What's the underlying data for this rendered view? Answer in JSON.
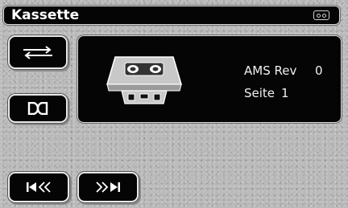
{
  "title_bar": {
    "title": "Kassette",
    "icon": "cassette-icon"
  },
  "buttons": {
    "repeat": {
      "icon": "repeat-arrows-icon"
    },
    "dolby": {
      "icon": "dolby-icon"
    },
    "rewind": {
      "icon": "skip-back-icon"
    },
    "forward": {
      "icon": "skip-forward-icon"
    }
  },
  "display": {
    "cassette_image": "cassette-icon",
    "ams_label": "AMS Rev",
    "ams_value": "0",
    "side_label": "Seite",
    "side_value": "1"
  },
  "colors": {
    "background": "#b9b9b9",
    "panel": "#050505",
    "text": "#ffffff",
    "cassette_body": "#c8c8c8"
  }
}
